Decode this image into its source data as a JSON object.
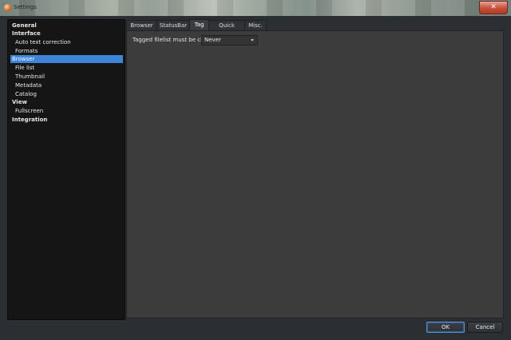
{
  "window": {
    "title": "Settings",
    "close_symbol": "✕"
  },
  "sidebar": {
    "items": [
      {
        "label": "General",
        "kind": "section"
      },
      {
        "label": "Interface",
        "kind": "section"
      },
      {
        "label": "Auto text correction",
        "kind": "child"
      },
      {
        "label": "Formats",
        "kind": "child"
      },
      {
        "label": "Browser",
        "kind": "section",
        "selected": true
      },
      {
        "label": "File list",
        "kind": "child"
      },
      {
        "label": "Thumbnail",
        "kind": "child"
      },
      {
        "label": "Metadata",
        "kind": "child"
      },
      {
        "label": "Catalog",
        "kind": "child"
      },
      {
        "label": "View",
        "kind": "section"
      },
      {
        "label": "Fullscreen",
        "kind": "child"
      },
      {
        "label": "Integration",
        "kind": "section"
      }
    ]
  },
  "tabs": [
    {
      "label": "Browser"
    },
    {
      "label": "StatusBar"
    },
    {
      "label": "Tag",
      "active": true
    },
    {
      "label": "Quick search"
    },
    {
      "label": "Misc."
    }
  ],
  "tag_panel": {
    "tagged_filelist_label": "Tagged filelist must be cleared",
    "tagged_filelist_value": "Never"
  },
  "buttons": {
    "ok": "OK",
    "cancel": "Cancel"
  },
  "colors": {
    "selection": "#3c85d8",
    "panel_bg": "#3c3c3c",
    "tree_bg": "#151515"
  }
}
